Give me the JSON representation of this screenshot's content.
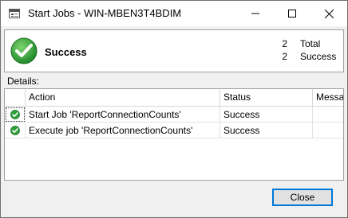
{
  "window": {
    "title": "Start Jobs - WIN-MBEN3T4BDIM"
  },
  "summary": {
    "status": "Success",
    "total_count": "2",
    "total_label": "Total",
    "success_count": "2",
    "success_label": "Success"
  },
  "details_label": "Details:",
  "grid": {
    "columns": [
      "Action",
      "Status",
      "Messa"
    ],
    "rows": [
      {
        "action": "Start Job 'ReportConnectionCounts'",
        "status": "Success",
        "message": ""
      },
      {
        "action": "Execute job 'ReportConnectionCounts'",
        "status": "Success",
        "message": ""
      }
    ]
  },
  "buttons": {
    "close_label": "Close"
  },
  "colors": {
    "success_green": "#2fa13a",
    "accent_blue": "#0078d7"
  }
}
